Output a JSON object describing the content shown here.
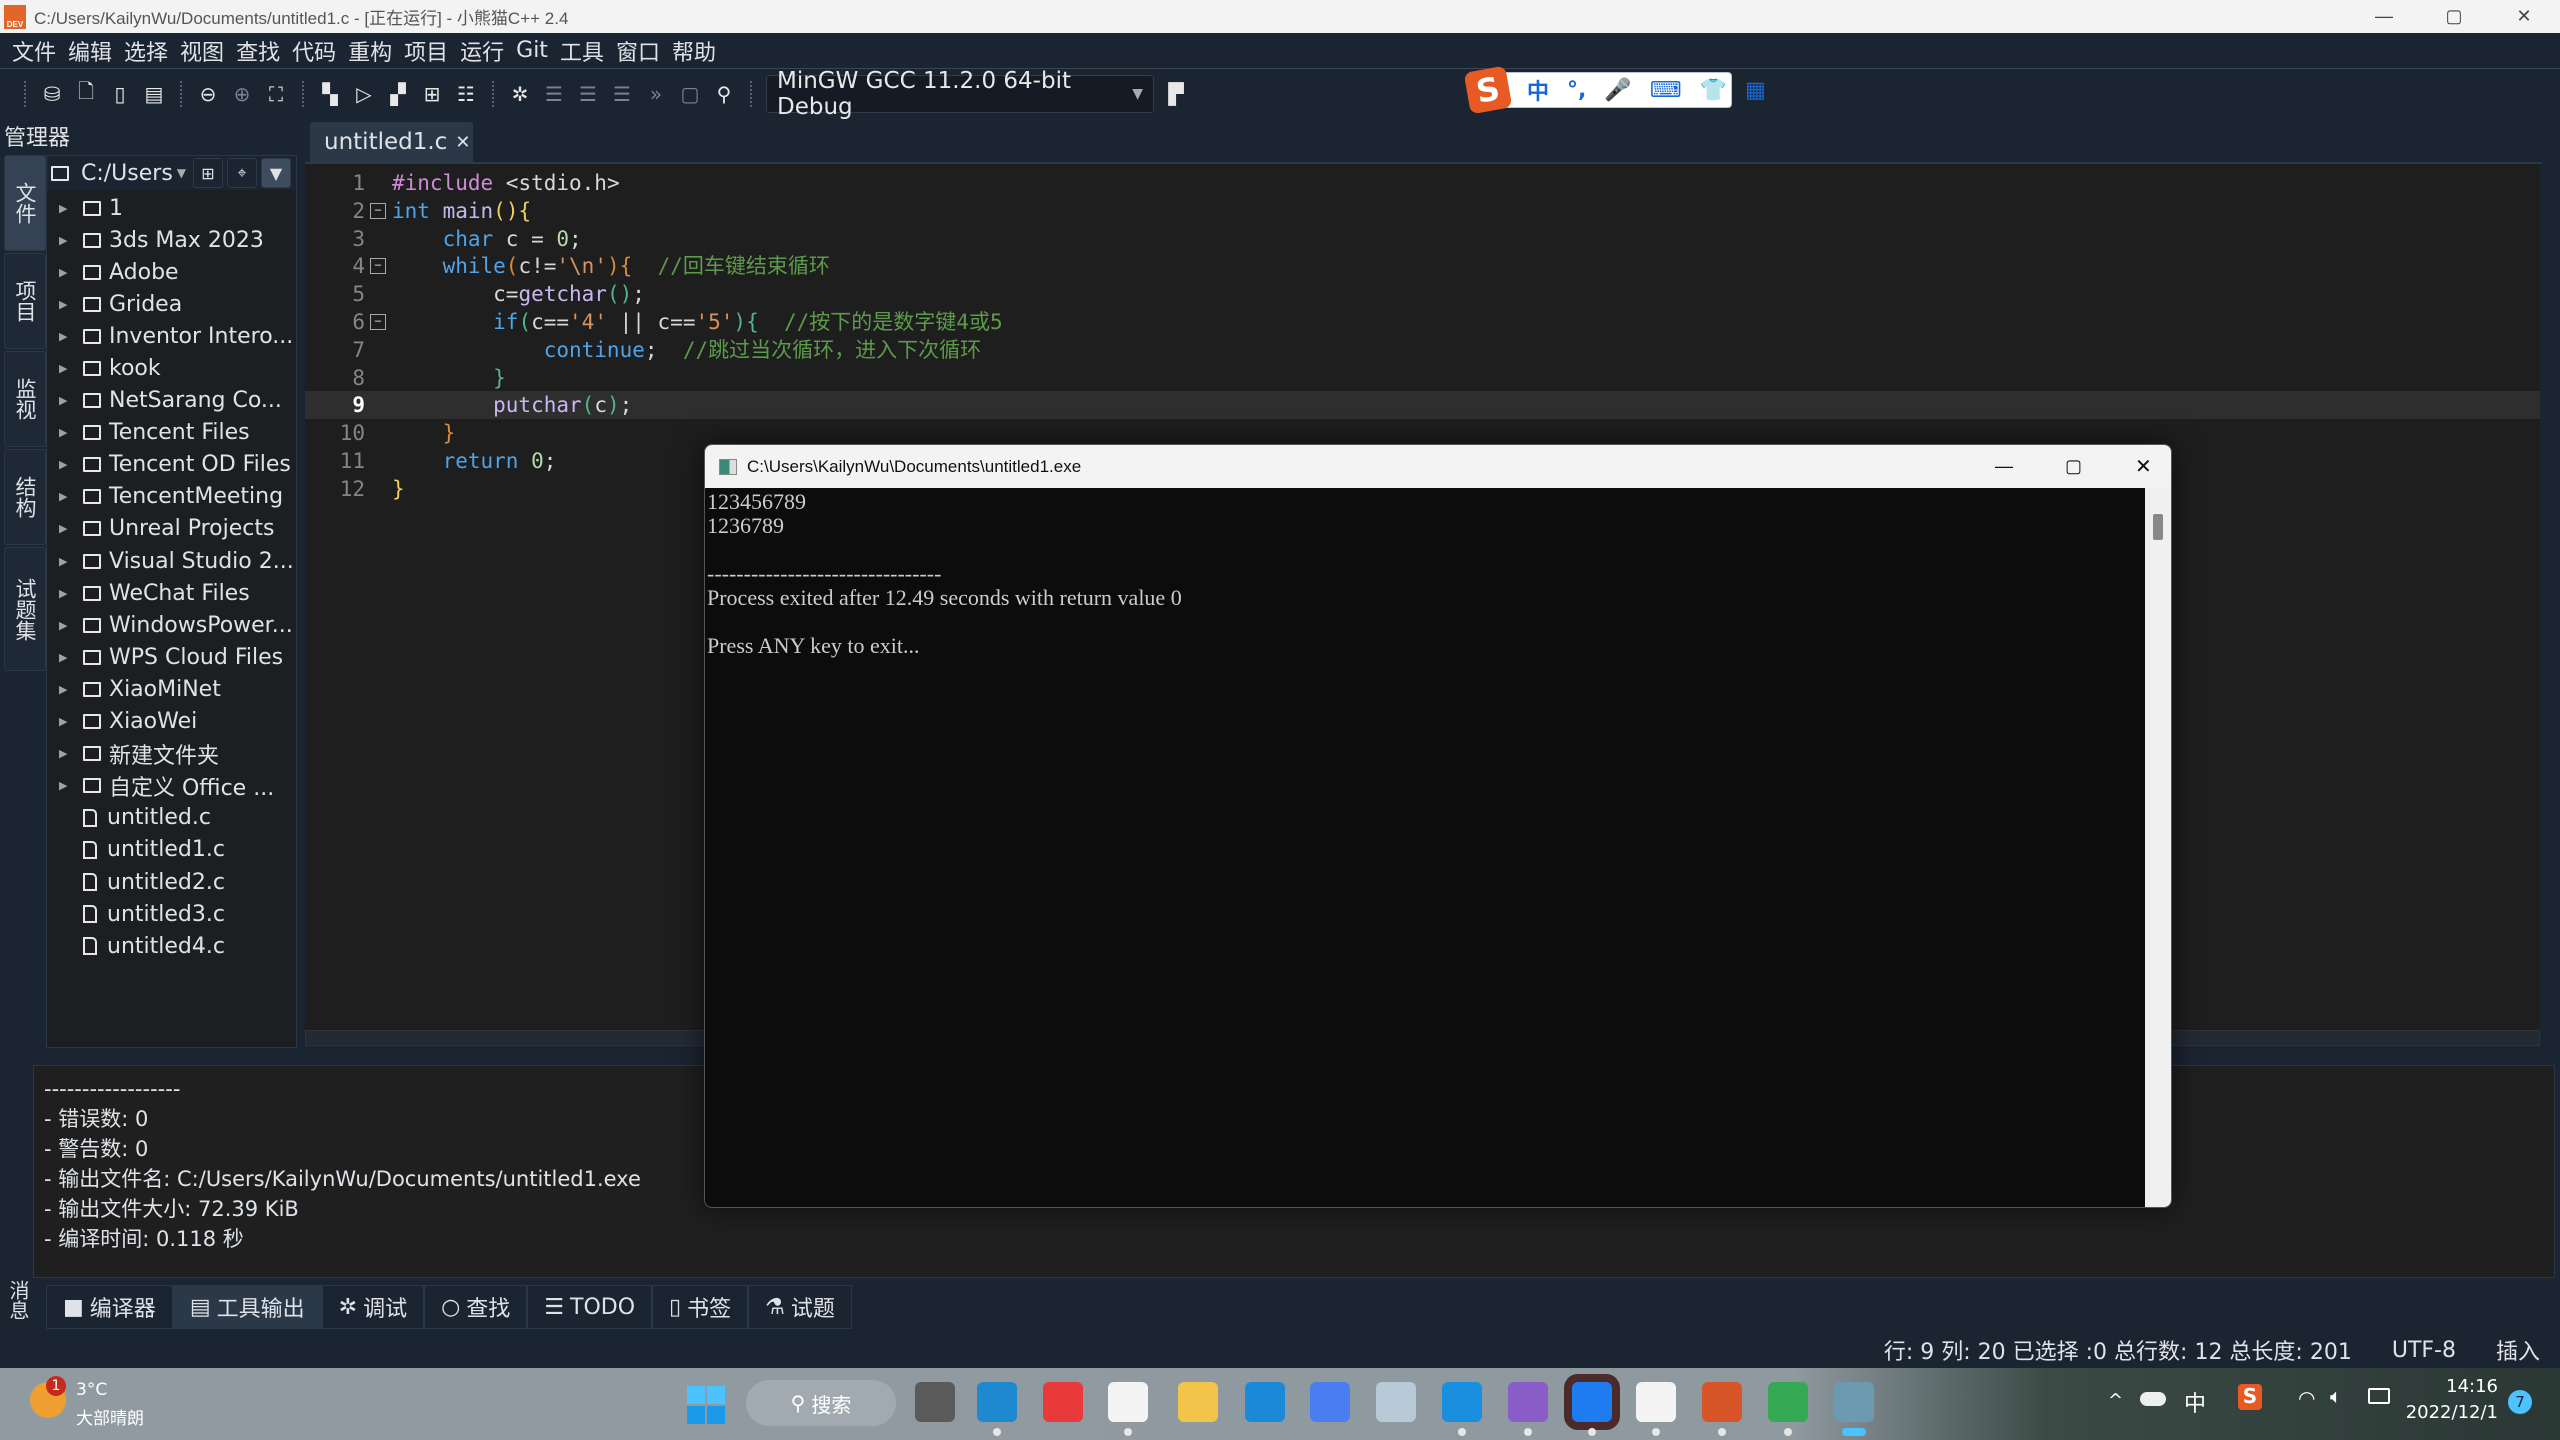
{
  "window": {
    "title": "C:/Users/KailynWu/Documents/untitled1.c - [正在运行] - 小熊猫C++ 2.4",
    "minimize": "—",
    "maximize": "▢",
    "close": "✕"
  },
  "menu": [
    "文件",
    "编辑",
    "选择",
    "视图",
    "查找",
    "代码",
    "重构",
    "项目",
    "运行",
    "Git",
    "工具",
    "窗口",
    "帮助"
  ],
  "toolbar": {
    "compiler": "MinGW GCC 11.2.0 64-bit Debug"
  },
  "ime": {
    "items": [
      "中",
      "°,",
      "🎤",
      "⌨",
      "👕",
      "▦"
    ]
  },
  "left_panel": {
    "title": "管理器",
    "vertical_tabs": [
      "文件",
      "项目",
      "监视",
      "结构",
      "试题集"
    ],
    "path": "C:/Users",
    "folders": [
      "1",
      "3ds Max 2023",
      "Adobe",
      "Gridea",
      "Inventor Intero...",
      "kook",
      "NetSarang Co...",
      "Tencent Files",
      "Tencent OD Files",
      "TencentMeeting",
      "Unreal Projects",
      "Visual Studio 2...",
      "WeChat Files",
      "WindowsPower...",
      "WPS Cloud Files",
      "XiaoMiNet",
      "XiaoWei",
      "新建文件夹",
      "自定义 Office ..."
    ],
    "files": [
      "untitled.c",
      "untitled1.c",
      "untitled2.c",
      "untitled3.c",
      "untitled4.c"
    ]
  },
  "editor": {
    "tab": "untitled1.c",
    "tab_close": "✕",
    "current_line": 9,
    "lines": [
      [
        [
          "#include",
          "pp"
        ],
        [
          " <stdio.h>",
          "tx"
        ]
      ],
      [
        [
          "int",
          "kw"
        ],
        [
          " ",
          "tx"
        ],
        [
          "main",
          "fn"
        ],
        [
          "()",
          "b1"
        ],
        [
          "{",
          "b1"
        ]
      ],
      [
        [
          "    char",
          "kw"
        ],
        [
          " c = ",
          "tx"
        ],
        [
          "0",
          "num"
        ],
        [
          ";",
          "tx"
        ]
      ],
      [
        [
          "    while",
          "kw"
        ],
        [
          "(",
          "b2"
        ],
        [
          "c!=",
          "tx"
        ],
        [
          "'\\n'",
          "str"
        ],
        [
          ")",
          "b2"
        ],
        [
          "{",
          "b2"
        ],
        [
          "  //回车键结束循环",
          "cm"
        ]
      ],
      [
        [
          "        c=",
          "tx"
        ],
        [
          "getchar",
          "fn"
        ],
        [
          "()",
          "b3"
        ],
        [
          ";",
          "tx"
        ]
      ],
      [
        [
          "        if",
          "kw"
        ],
        [
          "(",
          "b3"
        ],
        [
          "c==",
          "tx"
        ],
        [
          "'4'",
          "str"
        ],
        [
          " || c==",
          "tx"
        ],
        [
          "'5'",
          "str"
        ],
        [
          ")",
          "b3"
        ],
        [
          "{",
          "b3"
        ],
        [
          "  //按下的是数字键4或5",
          "cm"
        ]
      ],
      [
        [
          "            continue",
          "kw"
        ],
        [
          ";",
          "tx"
        ],
        [
          "  //跳过当次循环，进入下次循环",
          "cm"
        ]
      ],
      [
        [
          "        }",
          "b3"
        ]
      ],
      [
        [
          "        putchar",
          "fn"
        ],
        [
          "(",
          "b3"
        ],
        [
          "c",
          "tx"
        ],
        [
          ")",
          "b3"
        ],
        [
          ";",
          "tx"
        ]
      ],
      [
        [
          "    }",
          "b2"
        ]
      ],
      [
        [
          "    return",
          "kw"
        ],
        [
          " ",
          "tx"
        ],
        [
          "0",
          "num"
        ],
        [
          ";",
          "tx"
        ]
      ],
      [
        [
          "}",
          "b1"
        ]
      ]
    ]
  },
  "output": {
    "lines": [
      "------------------",
      "- 错误数: 0",
      "- 警告数: 0",
      "- 输出文件名: C:/Users/KailynWu/Documents/untitled1.exe",
      "- 输出文件大小: 72.39 KiB",
      "- 编译时间: 0.118 秒"
    ]
  },
  "bottom_tabs": [
    "编译器",
    "工具输出",
    "调试",
    "查找",
    "TODO",
    "书签",
    "试题"
  ],
  "bottom_tab_icons": [
    "■",
    "▤",
    "✲",
    "○",
    "☰",
    "▯",
    "⚗"
  ],
  "messages_label": "消息",
  "status": {
    "position": "行: 9 列: 20 已选择 :0 总行数: 12 总长度: 201",
    "encoding": "UTF-8",
    "mode": "插入"
  },
  "console": {
    "title": "C:\\Users\\KailynWu\\Documents\\untitled1.exe",
    "body": "123456789\n1236789\n\n--------------------------------\nProcess exited after 12.49 seconds with return value 0\n\nPress ANY key to exit..."
  },
  "taskbar": {
    "weather_temp": "3°C",
    "weather_desc": "大部晴朗",
    "weather_badge": "1",
    "search": "搜索",
    "tray_ime": "中",
    "time": "14:16",
    "date": "2022/12/1",
    "notifications": "7",
    "apps": [
      {
        "name": "task-view",
        "color": "#5a5a5a"
      },
      {
        "name": "edge",
        "color": "#1e88d0"
      },
      {
        "name": "app-red",
        "color": "#e83a3a"
      },
      {
        "name": "store",
        "color": "#f4f4f4"
      },
      {
        "name": "explorer",
        "color": "#f2c44a"
      },
      {
        "name": "help",
        "color": "#1a8ad8"
      },
      {
        "name": "app-blue",
        "color": "#4a7df0"
      },
      {
        "name": "monitor",
        "color": "#b8cad8"
      },
      {
        "name": "mail",
        "color": "#1a8fe0"
      },
      {
        "name": "visual-studio",
        "color": "#8a5cc8"
      },
      {
        "name": "feishu",
        "color": "#1e7cf0"
      },
      {
        "name": "typora",
        "color": "#f4f4f4"
      },
      {
        "name": "redpanda-cpp",
        "color": "#d8552a"
      },
      {
        "name": "chrome",
        "color": "#34a853"
      },
      {
        "name": "console",
        "color": "#6c9ab0"
      }
    ]
  }
}
